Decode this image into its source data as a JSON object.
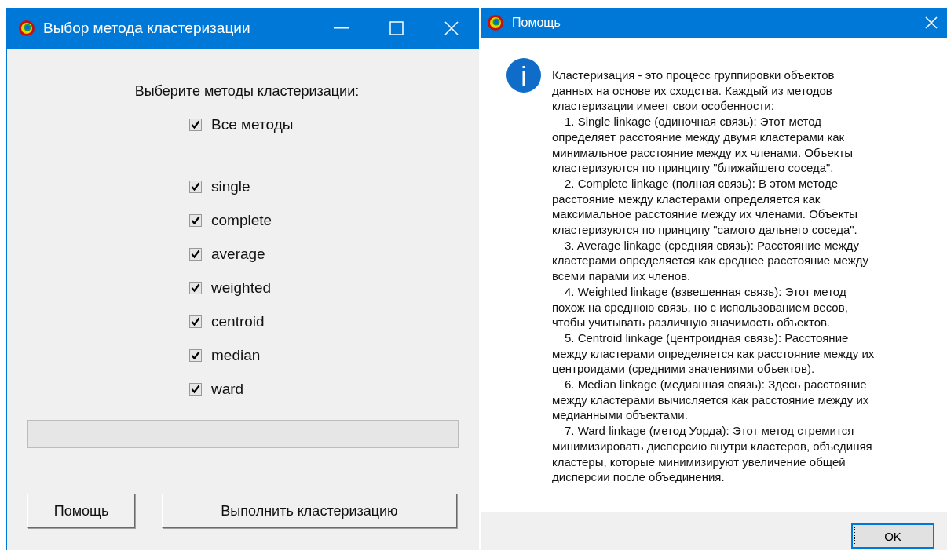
{
  "cluster_window": {
    "title": "Выбор метода кластеризации",
    "prompt": "Выберите методы кластеризации:",
    "all_methods": {
      "label": "Все методы",
      "checked": true
    },
    "methods": [
      {
        "label": "single",
        "checked": true
      },
      {
        "label": "complete",
        "checked": true
      },
      {
        "label": "average",
        "checked": true
      },
      {
        "label": "weighted",
        "checked": true
      },
      {
        "label": "centroid",
        "checked": true
      },
      {
        "label": "median",
        "checked": true
      },
      {
        "label": "ward",
        "checked": true
      }
    ],
    "progress": {
      "level": 0
    },
    "buttons": [
      "Помощь",
      "Выполнить кластеризацию"
    ]
  },
  "help_window": {
    "title": "Помощь",
    "lines": [
      {
        "text": "Кластеризация - это процесс группировки объектов",
        "indent": false
      },
      {
        "text": "данных на основе их сходства. Каждый из методов",
        "indent": false
      },
      {
        "text": "кластеризации имеет свои особенности:",
        "indent": false
      },
      {
        "text": "1. Single linkage (одиночная связь): Этот метод",
        "indent": true
      },
      {
        "text": "определяет расстояние между двумя кластерами как",
        "indent": false
      },
      {
        "text": "минимальное расстояние между их членами. Объекты",
        "indent": false
      },
      {
        "text": "кластеризуются по принципу \"ближайшего соседа\".",
        "indent": false
      },
      {
        "text": "2. Complete linkage (полная связь): В этом методе",
        "indent": true
      },
      {
        "text": "расстояние между кластерами определяется как",
        "indent": false
      },
      {
        "text": "максимальное расстояние между их членами. Объекты",
        "indent": false
      },
      {
        "text": "кластеризуются по принципу \"самого дальнего соседа\".",
        "indent": false
      },
      {
        "text": "3. Average linkage (средняя связь): Расстояние между",
        "indent": true
      },
      {
        "text": "кластерами определяется как среднее расстояние между",
        "indent": false
      },
      {
        "text": "всеми парами их членов.",
        "indent": false
      },
      {
        "text": "4. Weighted linkage (взвешенная связь): Этот метод",
        "indent": true
      },
      {
        "text": "похож на среднюю связь, но с использованием весов,",
        "indent": false
      },
      {
        "text": "чтобы учитывать различную значимость объектов.",
        "indent": false
      },
      {
        "text": "5. Centroid linkage (центроидная связь): Расстояние",
        "indent": true
      },
      {
        "text": "между кластерами определяется как расстояние между их",
        "indent": false
      },
      {
        "text": "центроидами (средними значениями объектов).",
        "indent": false
      },
      {
        "text": "6. Median linkage (медианная связь): Здесь расстояние",
        "indent": true
      },
      {
        "text": "между кластерами вычисляется как расстояние между их",
        "indent": false
      },
      {
        "text": "медианными объектами.",
        "indent": false
      },
      {
        "text": "7. Ward linkage (метод Уорда): Этот метод стремится",
        "indent": true
      },
      {
        "text": "минимизировать дисперсию внутри кластеров, объединяя",
        "indent": false
      },
      {
        "text": "кластеры, которые минимизируют увеличение общей",
        "indent": false
      },
      {
        "text": "дисперсии после объединения.",
        "indent": false
      }
    ],
    "ok_button": "OK"
  }
}
